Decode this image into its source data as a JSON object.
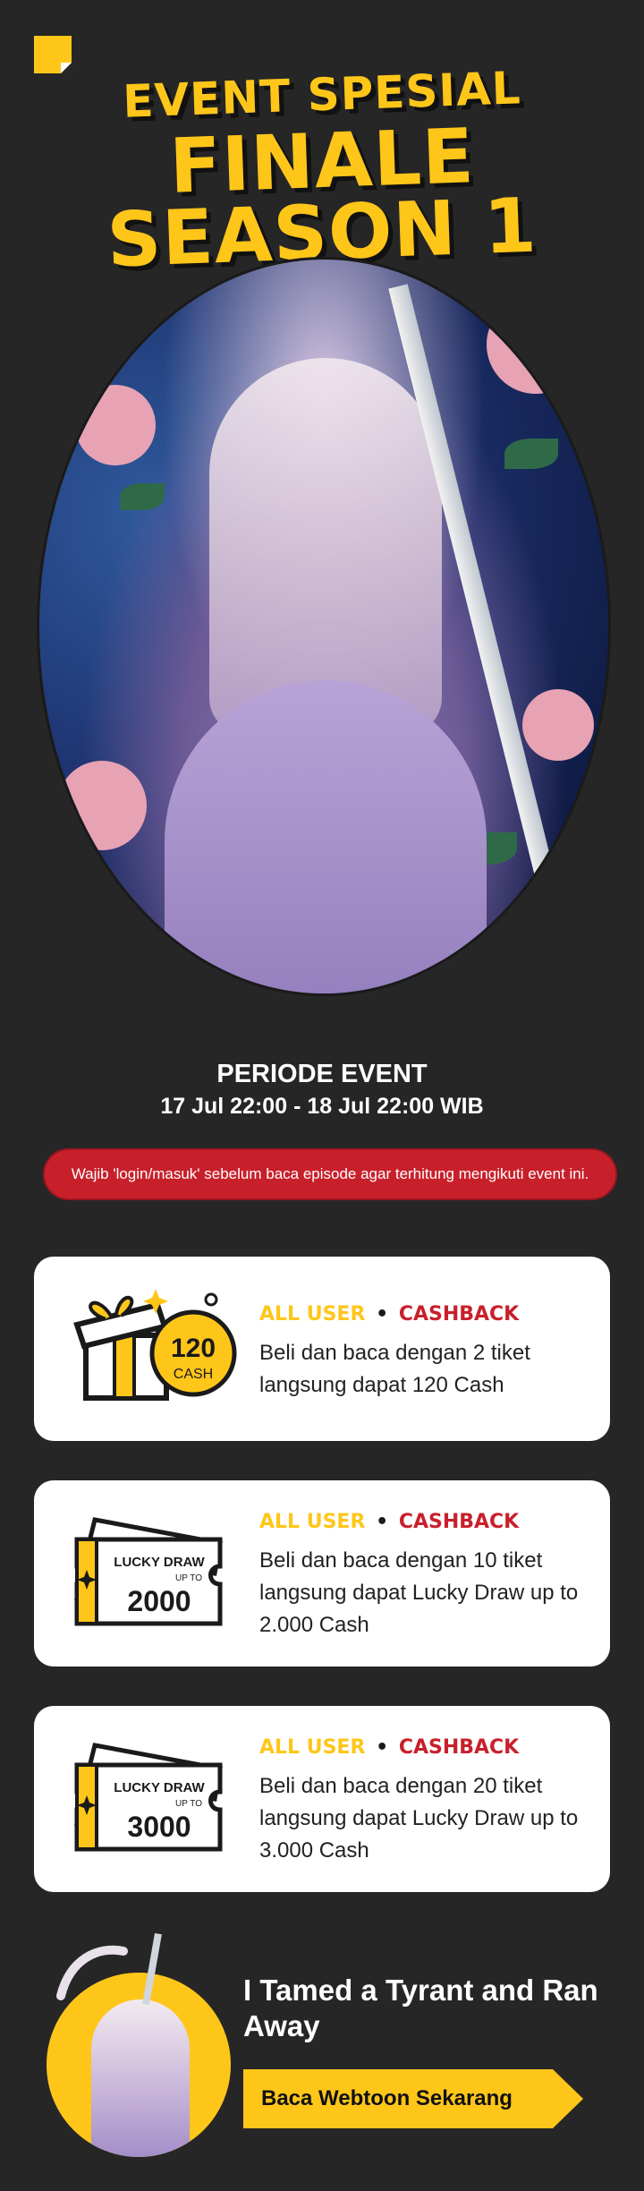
{
  "header": {
    "subtitle": "EVENT SPESIAL",
    "title_line1": "FINALE",
    "title_line2": "SEASON 1"
  },
  "period": {
    "title": "PERIODE EVENT",
    "dates": "17 Jul 22:00 - 18 Jul 22:00 WIB"
  },
  "notice": "Wajib 'login/masuk' sebelum baca episode agar terhitung mengikuti event ini.",
  "cards": [
    {
      "tag_user": "ALL USER",
      "tag_sep": "•",
      "tag_type": "CASHBACK",
      "desc": "Beli dan baca dengan 2 tiket langsung dapat 120 Cash",
      "icon": "gift-box-cash-icon",
      "icon_amount": "120",
      "icon_unit": "CASH"
    },
    {
      "tag_user": "ALL USER",
      "tag_sep": "•",
      "tag_type": "CASHBACK",
      "desc": "Beli dan baca dengan 10 tiket langsung dapat Lucky Draw up to 2.000 Cash",
      "icon": "lucky-draw-ticket-icon",
      "ticket_label": "LUCKY DRAW",
      "ticket_upto": "UP TO",
      "ticket_amount": "2000"
    },
    {
      "tag_user": "ALL USER",
      "tag_sep": "•",
      "tag_type": "CASHBACK",
      "desc": "Beli dan baca dengan 20 tiket langsung dapat Lucky Draw up to 3.000 Cash",
      "icon": "lucky-draw-ticket-icon",
      "ticket_label": "LUCKY DRAW",
      "ticket_upto": "UP TO",
      "ticket_amount": "3000"
    }
  ],
  "promo": {
    "title": "I Tamed a Tyrant and Ran Away",
    "button": "Baca Webtoon Sekarang"
  },
  "colors": {
    "background": "#262626",
    "accent_yellow": "#FFC61A",
    "accent_red": "#C8202B",
    "card": "#FFFFFF"
  }
}
